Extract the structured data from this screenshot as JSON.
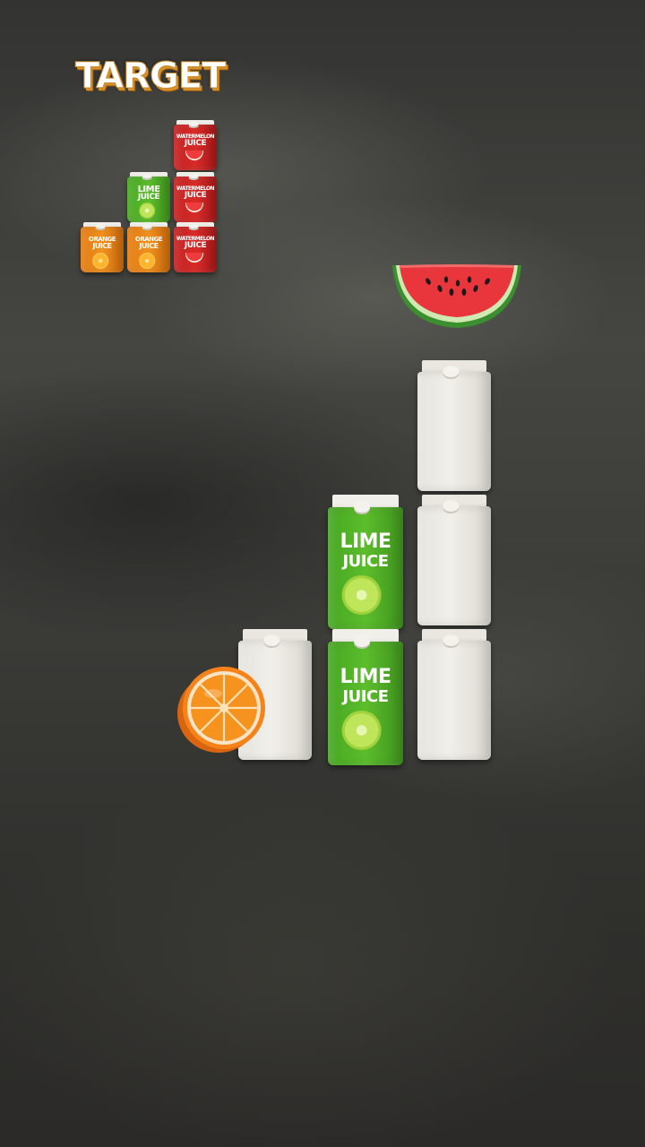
{
  "target": {
    "title": "TARGET",
    "cartons": [
      {
        "kind": "watermelon",
        "line1": "WATERMELON",
        "line2": "JUICE"
      },
      {
        "kind": "lime",
        "line1": "LIME",
        "line2": "JUICE"
      },
      {
        "kind": "watermelon",
        "line1": "WATERMELON",
        "line2": "JUICE"
      },
      {
        "kind": "orange",
        "line1": "ORANGE",
        "line2": "JUICE"
      },
      {
        "kind": "orange",
        "line1": "ORANGE",
        "line2": "JUICE"
      },
      {
        "kind": "watermelon",
        "line1": "WATERMELON",
        "line2": "JUICE"
      }
    ]
  },
  "board": {
    "floating_fruit": "watermelon-slice",
    "side_fruit": "orange-slice",
    "cartons": [
      {
        "kind": "blank"
      },
      {
        "kind": "lime",
        "line1": "LIME",
        "line2": "JUICE"
      },
      {
        "kind": "blank"
      },
      {
        "kind": "blank"
      },
      {
        "kind": "lime",
        "line1": "LIME",
        "line2": "JUICE"
      },
      {
        "kind": "blank"
      }
    ]
  },
  "colors": {
    "lime": "#54b427",
    "orange": "#ec8a17",
    "watermelon": "#d12828",
    "blank": "#ecebe5",
    "title_outline": "#c98a2e"
  }
}
